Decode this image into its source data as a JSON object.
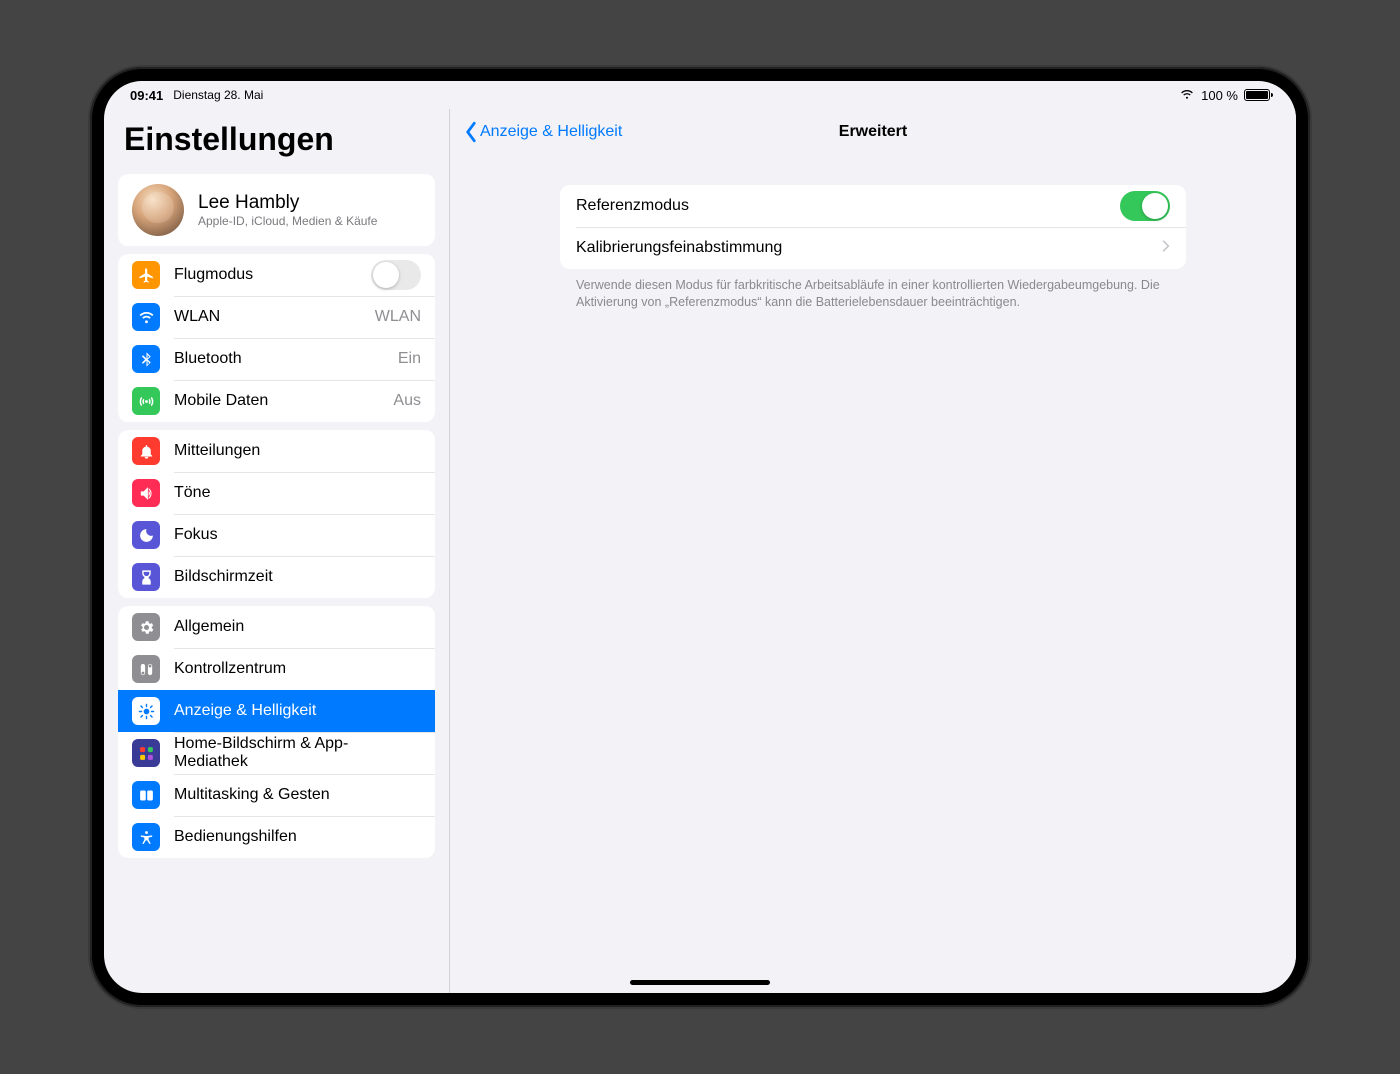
{
  "status": {
    "time": "09:41",
    "date": "Dienstag 28. Mai",
    "battery_pct": "100 %"
  },
  "sidebar": {
    "title": "Einstellungen",
    "profile": {
      "name": "Lee Hambly",
      "subtitle": "Apple-ID, iCloud, Medien & Käufe"
    },
    "group1": {
      "airplane": "Flugmodus",
      "wlan": "WLAN",
      "wlan_value": "WLAN",
      "bluetooth": "Bluetooth",
      "bluetooth_value": "Ein",
      "cellular": "Mobile Daten",
      "cellular_value": "Aus"
    },
    "group2": {
      "notifications": "Mitteilungen",
      "sounds": "Töne",
      "focus": "Fokus",
      "screentime": "Bildschirmzeit"
    },
    "group3": {
      "general": "Allgemein",
      "controlcenter": "Kontrollzentrum",
      "display": "Anzeige & Helligkeit",
      "homescreen": "Home-Bildschirm & App-Mediathek",
      "multitask": "Multitasking & Gesten",
      "accessibility": "Bedienungshilfen"
    }
  },
  "main": {
    "back_label": "Anzeige & Helligkeit",
    "title": "Erweitert",
    "reference_mode": "Referenzmodus",
    "calibration": "Kalibrierungsfeinabstimmung",
    "footer": "Verwende diesen Modus für farbkritische Arbeitsabläufe in einer kontrollierten Wiedergabeumgebung. Die Aktivierung von „Referenzmodus“ kann die Batterielebensdauer beeinträchtigen."
  }
}
